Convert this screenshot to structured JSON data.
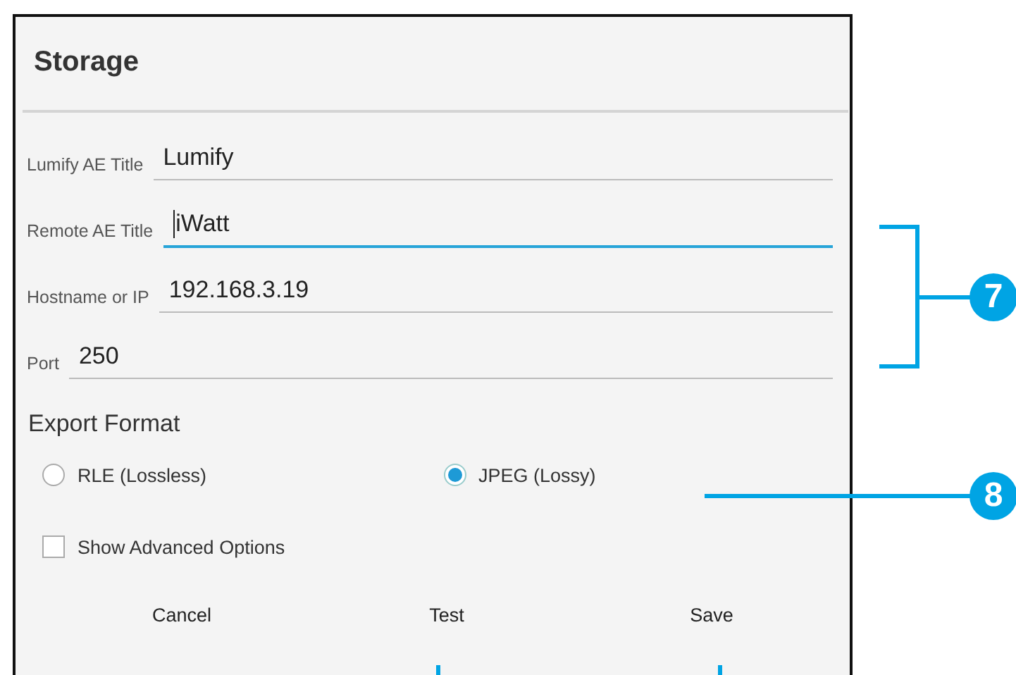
{
  "dialog": {
    "title": "Storage",
    "fields": [
      {
        "label": "Lumify AE Title",
        "value": "Lumify",
        "focused": false
      },
      {
        "label": "Remote AE Title",
        "value": "iWatt",
        "focused": true
      },
      {
        "label": "Hostname or IP",
        "value": "192.168.3.19",
        "focused": false
      },
      {
        "label": "Port",
        "value": "250",
        "focused": false
      }
    ],
    "export_format": {
      "heading": "Export Format",
      "options": [
        {
          "label": "RLE (Lossless)",
          "selected": false
        },
        {
          "label": "JPEG (Lossy)",
          "selected": true
        }
      ]
    },
    "advanced": {
      "label": "Show Advanced Options",
      "checked": false
    },
    "buttons": [
      "Cancel",
      "Test",
      "Save"
    ]
  },
  "callouts": [
    "7",
    "8"
  ]
}
